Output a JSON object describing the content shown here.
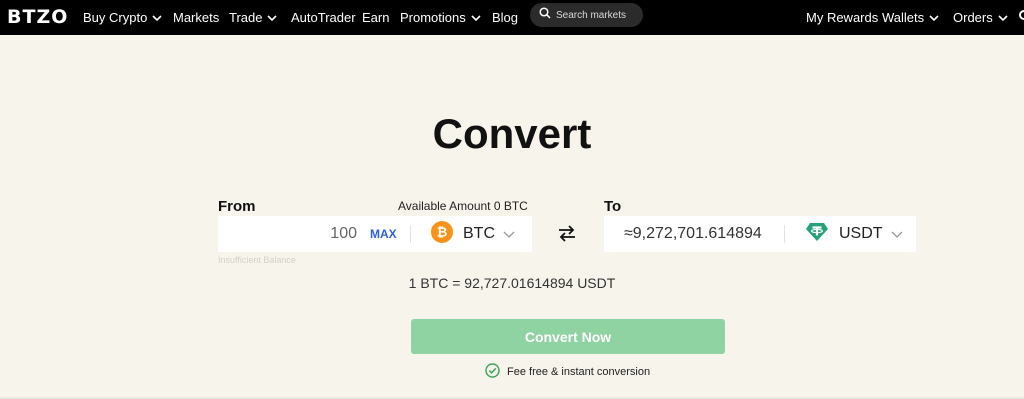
{
  "nav": {
    "logo": "BTZO",
    "items": [
      {
        "label": "Buy Crypto",
        "dropdown": true
      },
      {
        "label": "Markets",
        "dropdown": false
      },
      {
        "label": "Trade",
        "dropdown": true
      },
      {
        "label": "AutoTrader",
        "dropdown": false
      },
      {
        "label": "Earn",
        "dropdown": false
      },
      {
        "label": "Promotions",
        "dropdown": true
      },
      {
        "label": "Blog",
        "dropdown": false
      }
    ],
    "search_placeholder": "Search markets",
    "right_items": [
      {
        "label": "My Rewards",
        "dropdown": false
      },
      {
        "label": "Wallets",
        "dropdown": true
      },
      {
        "label": "Orders",
        "dropdown": true
      }
    ]
  },
  "main": {
    "title": "Convert",
    "from": {
      "label": "From",
      "available": "Available Amount 0 BTC",
      "amount": "100",
      "max_label": "MAX",
      "coin": "BTC",
      "coin_icon": "bitcoin-icon",
      "error": "Insufficient Balance"
    },
    "to": {
      "label": "To",
      "amount": "≈9,272,701.614894",
      "coin": "USDT",
      "coin_icon": "tether-icon"
    },
    "rate": "1 BTC = 92,727.01614894 USDT",
    "convert_button": "Convert Now",
    "fee_note": "Fee free & instant conversion"
  },
  "colors": {
    "background": "#f7f4ec",
    "nav_background": "#000000",
    "convert_button": "#8fd3a3",
    "max_link": "#2f5fe0",
    "bitcoin": "#f7931a",
    "tether": "#26a17b",
    "check": "#3aa657"
  }
}
